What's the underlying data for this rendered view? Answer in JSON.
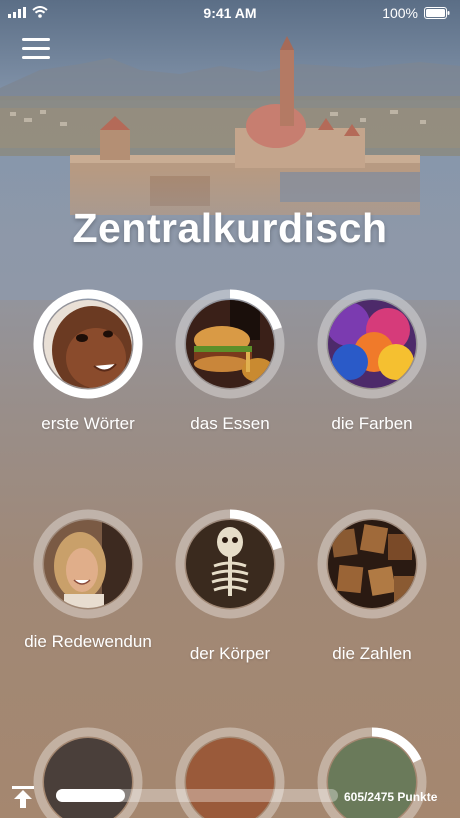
{
  "status": {
    "time": "9:41 AM",
    "battery": "100%"
  },
  "menu": {
    "icon": "hamburger-menu-icon"
  },
  "page": {
    "title": "Zentralkurdisch"
  },
  "categories": [
    {
      "label": "erste Wörter",
      "progress": 0.1,
      "image": "baby-face-photo"
    },
    {
      "label": "das Essen",
      "progress": 0.2,
      "image": "burger-fries-photo"
    },
    {
      "label": "die Farben",
      "progress": 0.0,
      "image": "color-powder-photo"
    },
    {
      "label": "die Redewendun",
      "progress": 0.0,
      "image": "smiling-woman-photo"
    },
    {
      "label": "der Körper",
      "progress": 0.2,
      "image": "skeleton-photo"
    },
    {
      "label": "die Zahlen",
      "progress": 0.0,
      "image": "number-blocks-photo"
    },
    {
      "label": "",
      "progress": 0.0,
      "image": "photo"
    },
    {
      "label": "",
      "progress": 0.0,
      "image": "photo"
    },
    {
      "label": "",
      "progress": 0.18,
      "image": "photo"
    }
  ],
  "footer": {
    "points_text": "605/2475 Punkte",
    "progress": 0.244
  }
}
